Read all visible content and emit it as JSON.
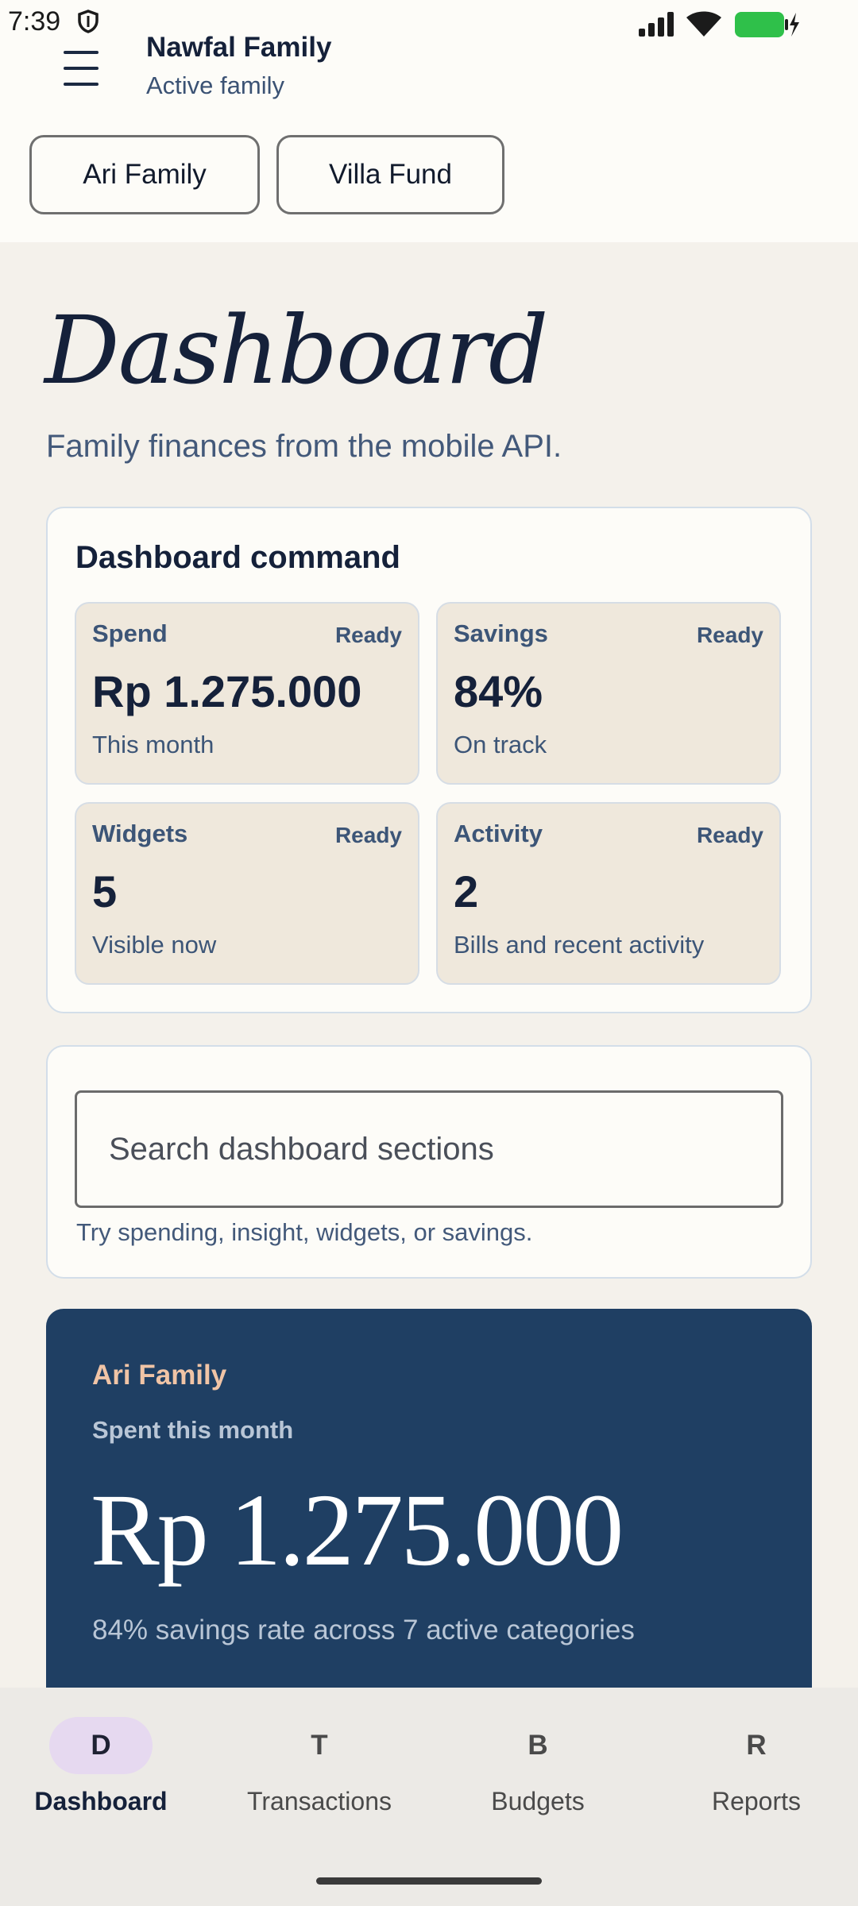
{
  "status_bar": {
    "time": "7:39"
  },
  "header": {
    "family_name": "Nawfal Family",
    "family_status": "Active family",
    "chips": [
      "Ari Family",
      "Villa Fund"
    ]
  },
  "page": {
    "title": "Dashboard",
    "subtitle": "Family finances from the mobile API."
  },
  "command": {
    "title": "Dashboard command",
    "cards": [
      {
        "label": "Spend",
        "status": "Ready",
        "value": "Rp 1.275.000",
        "note": "This month"
      },
      {
        "label": "Savings",
        "status": "Ready",
        "value": "84%",
        "note": "On track"
      },
      {
        "label": "Widgets",
        "status": "Ready",
        "value": "5",
        "note": "Visible now"
      },
      {
        "label": "Activity",
        "status": "Ready",
        "value": "2",
        "note": "Bills and recent activity"
      }
    ]
  },
  "search": {
    "placeholder": "Search dashboard sections",
    "hint": "Try spending, insight, widgets, or savings."
  },
  "hero": {
    "family": "Ari Family",
    "label": "Spent this month",
    "amount": "Rp 1.275.000",
    "note": "84% savings rate across 7 active categories"
  },
  "nav": [
    {
      "letter": "D",
      "label": "Dashboard"
    },
    {
      "letter": "T",
      "label": "Transactions"
    },
    {
      "letter": "B",
      "label": "Budgets"
    },
    {
      "letter": "R",
      "label": "Reports"
    }
  ],
  "colors": {
    "accent": "#1f3f63",
    "hero_family": "#f0c4a6",
    "active_nav": "#e6d9f0"
  }
}
